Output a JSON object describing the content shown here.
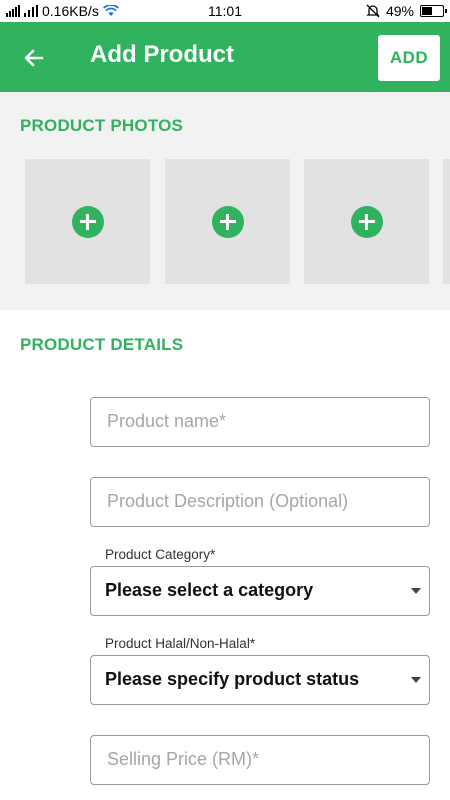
{
  "status_bar": {
    "network_speed": "0.16KB/s",
    "time": "11:01",
    "battery": "49%",
    "battery_level": 0.49
  },
  "appbar": {
    "back_icon": "arrow-left-icon",
    "title": "Add Product",
    "add_label": "ADD",
    "color": "#31b25e"
  },
  "photos": {
    "title": "PRODUCT PHOTOS",
    "tiles": [
      "add-photo",
      "add-photo",
      "add-photo",
      "add-photo"
    ]
  },
  "details": {
    "title": "PRODUCT DETAILS",
    "product_name": {
      "placeholder": "Product name*"
    },
    "product_description": {
      "placeholder": "Product Description (Optional)"
    },
    "category": {
      "label": "Product Category*",
      "value": "Please select a category"
    },
    "halal": {
      "label": "Product Halal/Non-Halal*",
      "value": "Please specify product status"
    },
    "selling_price": {
      "placeholder": "Selling Price (RM)*"
    }
  }
}
